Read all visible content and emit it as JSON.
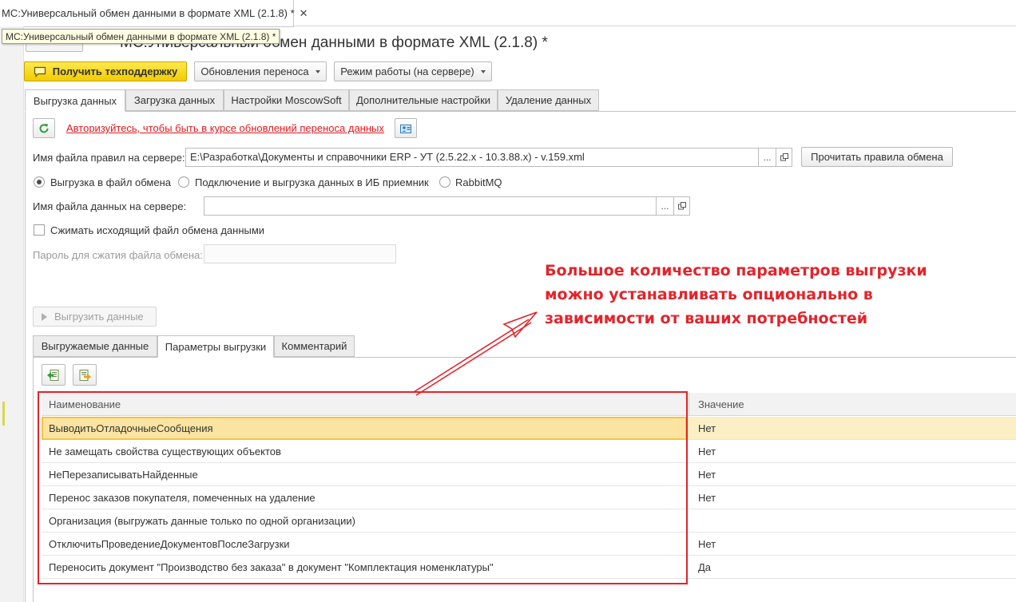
{
  "window": {
    "tab_title": "МС:Универсальный обмен данными в формате XML (2.1.8) *",
    "tab_close": "✕",
    "tooltip": "МС:Универсальный обмен данными в формате XML (2.1.8) *",
    "form_title": "МС:Универсальный обмен данными в формате XML (2.1.8) *"
  },
  "toolbar": {
    "support_label": "Получить техподдержку",
    "updates_label": "Обновления переноса",
    "mode_label": "Режим работы (на сервере)"
  },
  "tabs": [
    {
      "label": "Выгрузка данных"
    },
    {
      "label": "Загрузка данных"
    },
    {
      "label": "Настройки MoscowSoft"
    },
    {
      "label": "Дополнительные настройки"
    },
    {
      "label": "Удаление данных"
    }
  ],
  "export": {
    "auth_link": "Авторизуйтесь, чтобы быть в курсе обновлений переноса данных",
    "rules_file_label": "Имя файла правил на сервере:",
    "rules_file_value": "E:\\Разработка\\Документы и справочники ERP - УТ (2.5.22.x - 10.3.88.x) - v.159.xml",
    "read_rules_label": "Прочитать правила обмена",
    "ellipsis": "...",
    "radio_file": "Выгрузка в файл обмена",
    "radio_connect": "Подключение и выгрузка данных в ИБ приемник",
    "radio_rabbit": "RabbitMQ",
    "data_file_label": "Имя файла данных на сервере:",
    "data_file_value": "",
    "compress_label": "Сжимать исходящий файл обмена данными",
    "password_label": "Пароль для сжатия файла обмена:",
    "export_button": "Выгрузить данные"
  },
  "subtabs": [
    {
      "label": "Выгружаемые данные"
    },
    {
      "label": "Параметры выгрузки"
    },
    {
      "label": "Комментарий"
    }
  ],
  "params": {
    "headers": {
      "name": "Наименование",
      "value": "Значение"
    },
    "rows": [
      {
        "name": "ВыводитьОтладочныеСообщения",
        "value": "Нет"
      },
      {
        "name": "Не замещать свойства существующих объектов",
        "value": "Нет"
      },
      {
        "name": "НеПерезаписыватьНайденные",
        "value": "Нет"
      },
      {
        "name": "Перенос заказов покупателя, помеченных на удаление",
        "value": "Нет"
      },
      {
        "name": "Организация (выгружать данные только по одной организации)",
        "value": ""
      },
      {
        "name": "ОтключитьПроведениеДокументовПослеЗагрузки",
        "value": "Нет"
      },
      {
        "name": "Переносить документ \"Производство без заказа\" в документ \"Комплектация номенклатуры\"",
        "value": "Да"
      }
    ]
  },
  "annotation": {
    "line1": "Большое количество параметров выгрузки",
    "line2": "можно устанавливать опционально в",
    "line3": "зависимости от ваших потребностей"
  },
  "colors": {
    "accent_yellow": "#f2cc00",
    "link_red": "#e0191e",
    "annotation_red": "#e3242b",
    "selection": "#fbe4a1"
  }
}
